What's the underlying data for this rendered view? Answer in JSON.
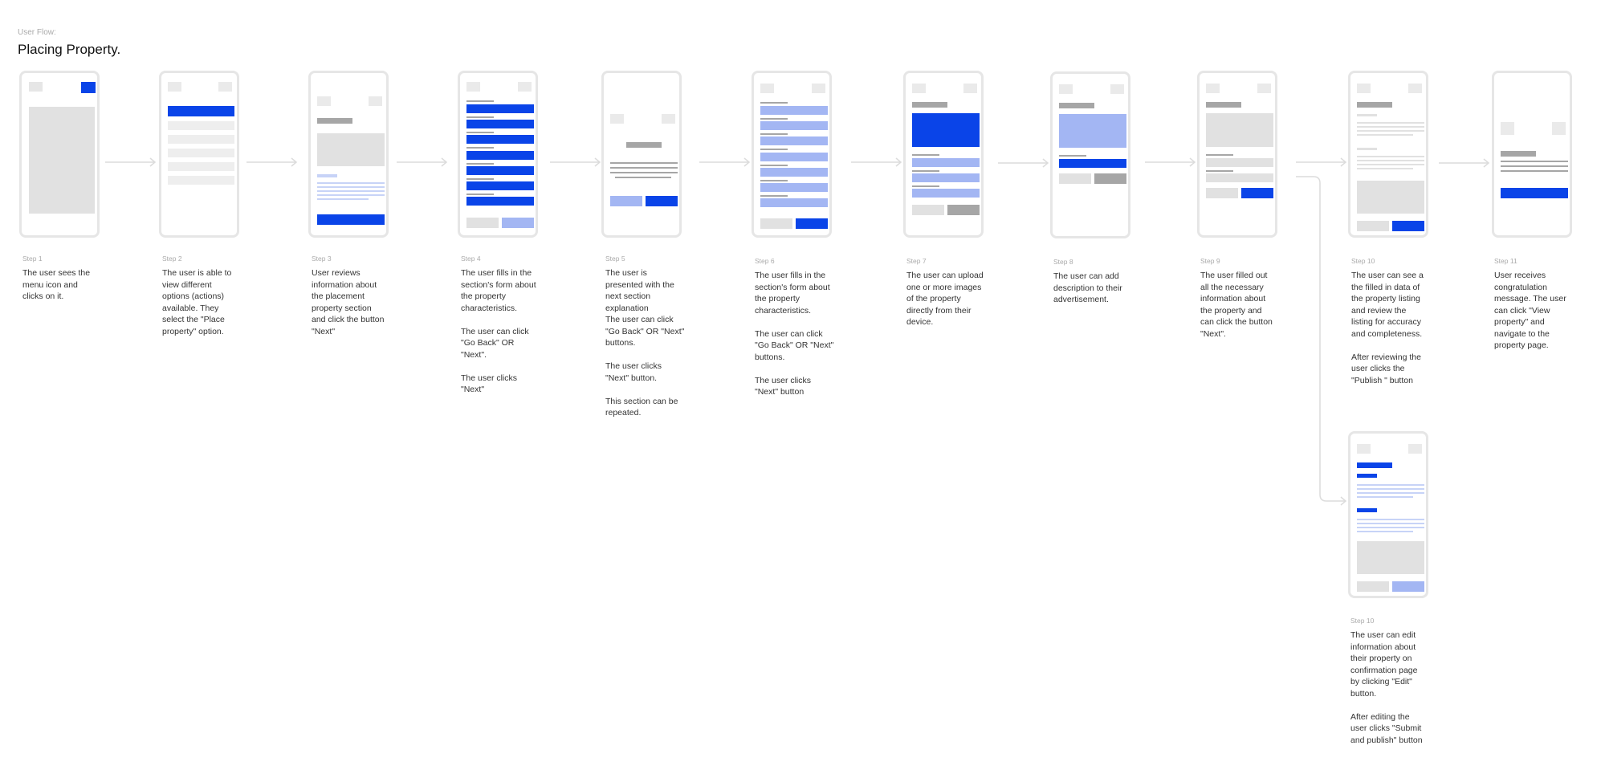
{
  "header": {
    "subtitle": "User Flow:",
    "title": "Placing Property."
  },
  "colors": {
    "primary": "#0a44e8",
    "light_blue": "#a3b6f3",
    "gray": "#e1e1e1",
    "dark_gray": "#a6a6a6",
    "line": "#dcdcdc"
  },
  "steps": [
    {
      "label": "Step 1",
      "text": "The user sees the\nmenu icon and\nclicks on it."
    },
    {
      "label": "Step 2",
      "text": "The user is able to\nview different\noptions (actions)\navailable. They\nselect the \"Place\nproperty\" option."
    },
    {
      "label": "Step 3",
      "text": "User reviews\ninformation about\nthe placement\nproperty section\nand click the button\n\"Next\""
    },
    {
      "label": "Step 4",
      "text": "The user fills in the\nsection's form about\nthe property\ncharacteristics.\n\nThe user can click\n\"Go Back\" OR\n\"Next\".\n\nThe user clicks\n\"Next\""
    },
    {
      "label": "Step 5",
      "text": "The user is\npresented with the\nnext section\nexplanation\nThe user can click\n\"Go Back\" OR \"Next\"\nbuttons.\n\nThe user clicks\n\"Next\" button.\n\nThis section can be\nrepeated."
    },
    {
      "label": "Step 6",
      "text": "The user fills in the\nsection's form about\nthe property\ncharacteristics.\n\nThe user can click\n\"Go Back\" OR \"Next\"\nbuttons.\n\nThe user clicks\n\"Next\" button"
    },
    {
      "label": "Step 7",
      "text": "The user can upload\none or more images\nof the property\ndirectly from their\ndevice."
    },
    {
      "label": "Step 8",
      "text": "The user can add\ndescription to their\nadvertisement."
    },
    {
      "label": "Step 9",
      "text": "The user filled out\nall the necessary\ninformation about\nthe property and\ncan click the button\n\"Next\"."
    },
    {
      "label": "Step 10",
      "text": "The user can see a\nthe filled in data of\nthe property listing\nand review the\nlisting for accuracy\nand completeness.\n\nAfter reviewing the\nuser clicks the\n\"Publish \" button"
    },
    {
      "label": "Step 11",
      "text": "User receives\ncongratulation\nmessage. The user\ncan click \"View\nproperty\" and\nnavigate to the\nproperty page."
    },
    {
      "label": "Step 10",
      "text": "The user can edit\ninformation about\ntheir property on\nconfirmation page\nby clicking \"Edit\"\nbutton.\n\nAfter editing the\nuser clicks \"Submit\nand publish\" button"
    }
  ]
}
